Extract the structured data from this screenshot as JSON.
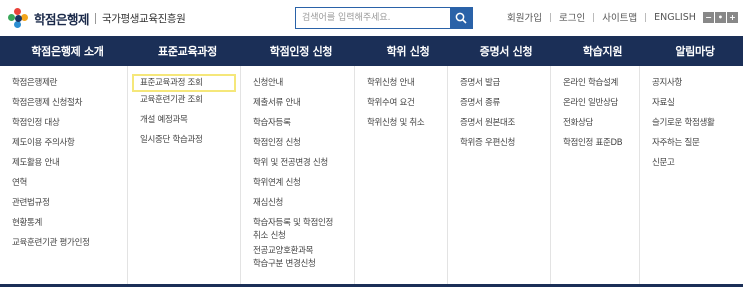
{
  "header": {
    "logo_title": "학점은행제",
    "logo_org": "국가평생교육진흥원",
    "search_placeholder": "검색어를 입력해주세요.",
    "util_links": [
      "회원가입",
      "로그인",
      "사이트맵",
      "ENGLISH"
    ],
    "font_controls": [
      "−",
      "•",
      "+"
    ]
  },
  "nav": {
    "items": [
      "학점은행제 소개",
      "표준교육과정",
      "학점인정 신청",
      "학위 신청",
      "증명서 신청",
      "학습지원",
      "알림마당"
    ]
  },
  "menu": {
    "columns": [
      {
        "items": [
          [
            "학점은행제란"
          ],
          [
            "학점은행제 신청절차"
          ],
          [
            "학점인정 대상"
          ],
          [
            "제도이용 주의사항"
          ],
          [
            "제도활용 안내"
          ],
          [
            "연혁"
          ],
          [
            "관련법규정"
          ],
          [
            "현황통계"
          ],
          [
            "교육훈련기관 평가인정"
          ]
        ]
      },
      {
        "items": [
          [
            "표준교육과정 조회"
          ],
          [
            "교육훈련기관 조회"
          ],
          [
            "개설 예정과목"
          ],
          [
            "일시중단 학습과정"
          ]
        ],
        "active_index": 0
      },
      {
        "items": [
          [
            "신청안내"
          ],
          [
            "제출서류 안내"
          ],
          [
            "학습자등록"
          ],
          [
            "학점인정 신청"
          ],
          [
            "학위 및 전공변경 신청"
          ],
          [
            "학위연계 신청"
          ],
          [
            "재심신청"
          ],
          [
            "학습자등록 및 학점인정",
            "취소 신청"
          ],
          [
            "전공교양호환과목",
            "학습구분 변경신청"
          ]
        ]
      },
      {
        "items": [
          [
            "학위신청 안내"
          ],
          [
            "학위수여 요건"
          ],
          [
            "학위신청 및 취소"
          ]
        ]
      },
      {
        "items": [
          [
            "증명서 발급"
          ],
          [
            "증명서 종류"
          ],
          [
            "증명서 원본대조"
          ],
          [
            "학위증 우편신청"
          ]
        ]
      },
      {
        "items": [
          [
            "온라인 학습설계"
          ],
          [
            "온라인 일반상담"
          ],
          [
            "전화상담"
          ],
          [
            "학점인정 표준DB"
          ]
        ]
      },
      {
        "items": [
          [
            "공지사항"
          ],
          [
            "자료실"
          ],
          [
            "슬기로운 학점생활"
          ],
          [
            "자주하는 질문"
          ],
          [
            "신문고"
          ]
        ]
      }
    ]
  },
  "colors": {
    "nav_bg": "#1b2f57",
    "search_accent": "#2a62a8",
    "highlight": "#f5e77a"
  }
}
